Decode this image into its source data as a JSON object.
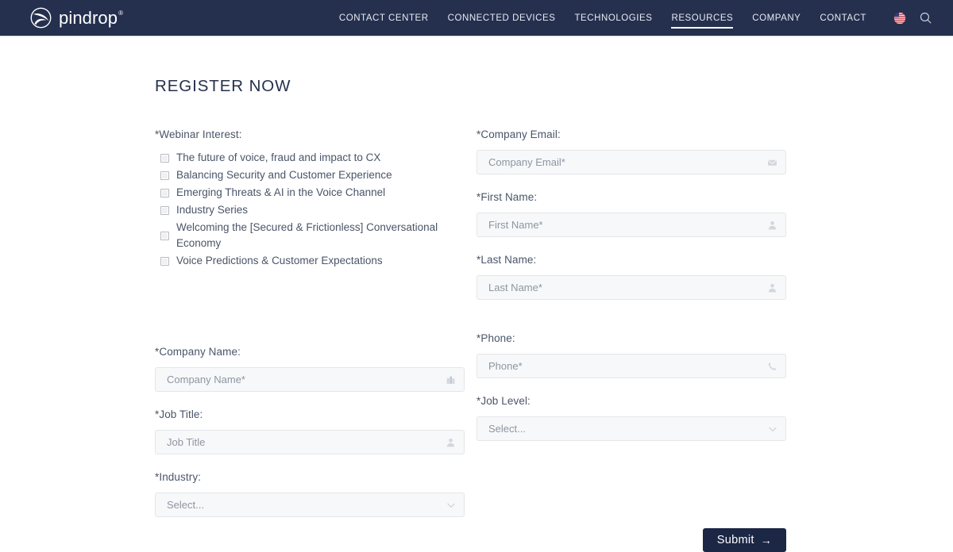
{
  "header": {
    "brand_name": "pindrop",
    "brand_registered": "®",
    "nav_items": [
      {
        "label": "CONTACT CENTER",
        "active": false
      },
      {
        "label": "CONNECTED DEVICES",
        "active": false
      },
      {
        "label": "TECHNOLOGIES",
        "active": false
      },
      {
        "label": "RESOURCES",
        "active": true
      },
      {
        "label": "COMPANY",
        "active": false
      },
      {
        "label": "CONTACT",
        "active": false
      }
    ],
    "locale_icon": "us-flag-icon",
    "search_icon": "search-icon",
    "background_color": "#25304f"
  },
  "page": {
    "title": "REGISTER NOW"
  },
  "form": {
    "webinar_interest": {
      "label": "*Webinar Interest:",
      "options": [
        {
          "label": "The future of voice, fraud and impact to CX",
          "checked": false
        },
        {
          "label": "Balancing Security and Customer Experience",
          "checked": false
        },
        {
          "label": "Emerging Threats & AI in the Voice Channel",
          "checked": false
        },
        {
          "label": "Industry Series",
          "checked": false
        },
        {
          "label": "Welcoming the [Secured & Frictionless] Conversational Economy",
          "checked": false
        },
        {
          "label": "Voice Predictions & Customer Expectations",
          "checked": false
        }
      ]
    },
    "company_email": {
      "label": "*Company Email:",
      "placeholder": "Company Email*",
      "value": "",
      "icon": "envelope-icon"
    },
    "first_name": {
      "label": "*First Name:",
      "placeholder": "First Name*",
      "value": "",
      "icon": "person-icon"
    },
    "last_name": {
      "label": "*Last Name:",
      "placeholder": "Last Name*",
      "value": "",
      "icon": "person-icon"
    },
    "company_name": {
      "label": "*Company Name:",
      "placeholder": "Company Name*",
      "value": "",
      "icon": "building-icon"
    },
    "phone": {
      "label": "*Phone:",
      "placeholder": "Phone*",
      "value": "",
      "icon": "phone-icon"
    },
    "job_title": {
      "label": "*Job Title:",
      "placeholder": "Job Title",
      "value": "",
      "icon": "person-icon"
    },
    "job_level": {
      "label": "*Job Level:",
      "selected": "Select...",
      "icon": "chevron-down-icon"
    },
    "industry": {
      "label": "*Industry:",
      "selected": "Select...",
      "icon": "chevron-down-icon"
    },
    "submit": {
      "label": "Submit",
      "arrow": "→",
      "background_color": "#1c2745"
    }
  }
}
